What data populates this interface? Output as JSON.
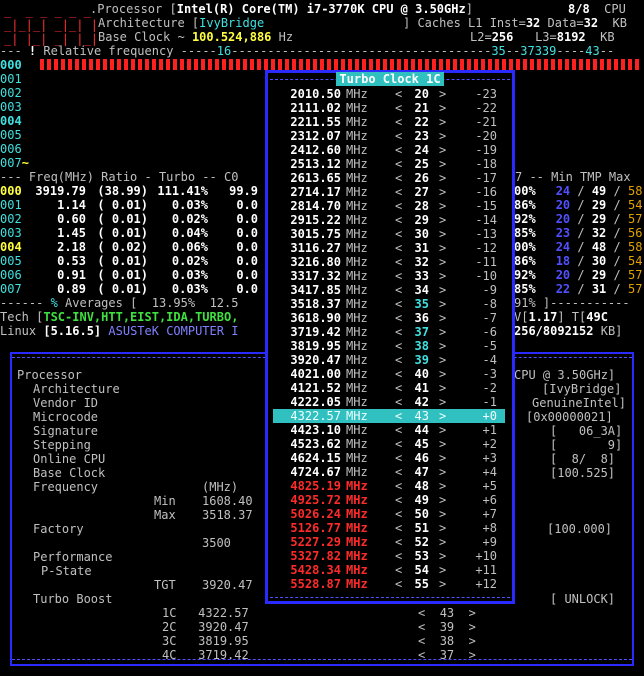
{
  "header": {
    "processor_label": "Processor [",
    "processor_name": "Intel(R) Core(TM) i7-3770K CPU @ 3.50GHz",
    "cpu_count": "8/8",
    "cpu_label": "CPU",
    "arch_label": "Architecture [",
    "arch_name": "IvyBridge",
    "caches_label": "] Caches L1 Inst=",
    "l1_inst": "32",
    "data_label": "Data=",
    "l1_data": "32",
    "kb": "KB",
    "base_clock_label": "Base Clock ~",
    "base_clock_value": "100.524,886",
    "hz": "Hz",
    "l2_label": "L2=",
    "l2": "256",
    "l3_label": "L3=",
    "l3": "8192"
  },
  "relfreq": {
    "label": "Relative frequency",
    "scale_a": "16",
    "scale_b": "35",
    "scale_c": "37",
    "scale_d": "339",
    "scale_e": "43"
  },
  "cores": [
    "000",
    "001",
    "002",
    "003",
    "004",
    "005",
    "006",
    "007"
  ],
  "freq_header": "--- Freq(MHz) Ratio - Turbo -- C0",
  "freq_header_right": "7 -- Min TMP Max",
  "freq_rows": [
    {
      "core": "000",
      "freq": "3919.79",
      "ratio": "(38.99)",
      "turbo": "111.41%",
      "c0": "99.9",
      "c7": "00%",
      "min": "24",
      "tmp": "49",
      "max": "58"
    },
    {
      "core": "001",
      "freq": "1.14",
      "ratio": "( 0.01)",
      "turbo": "0.03%",
      "c0": "0.0",
      "c7": "86%",
      "min": "20",
      "tmp": "29",
      "max": "54"
    },
    {
      "core": "002",
      "freq": "0.60",
      "ratio": "( 0.01)",
      "turbo": "0.02%",
      "c0": "0.0",
      "c7": "92%",
      "min": "20",
      "tmp": "29",
      "max": "57"
    },
    {
      "core": "003",
      "freq": "1.45",
      "ratio": "( 0.01)",
      "turbo": "0.04%",
      "c0": "0.0",
      "c7": "85%",
      "min": "23",
      "tmp": "32",
      "max": "56"
    },
    {
      "core": "004",
      "freq": "2.18",
      "ratio": "( 0.02)",
      "turbo": "0.06%",
      "c0": "0.0",
      "c7": "00%",
      "min": "24",
      "tmp": "48",
      "max": "58"
    },
    {
      "core": "005",
      "freq": "0.53",
      "ratio": "( 0.01)",
      "turbo": "0.02%",
      "c0": "0.0",
      "c7": "86%",
      "min": "18",
      "tmp": "30",
      "max": "54"
    },
    {
      "core": "006",
      "freq": "0.91",
      "ratio": "( 0.01)",
      "turbo": "0.03%",
      "c0": "0.0",
      "c7": "92%",
      "min": "20",
      "tmp": "29",
      "max": "57"
    },
    {
      "core": "007",
      "freq": "0.89",
      "ratio": "( 0.01)",
      "turbo": "0.03%",
      "c0": "0.0",
      "c7": "85%",
      "min": "22",
      "tmp": "31",
      "max": "57"
    }
  ],
  "averages": {
    "label": "Averages [",
    "turbo": "13.95%",
    "c0": "12.5",
    "c7": "91%"
  },
  "tech": {
    "label": "Tech [",
    "items": "TSC-INV,HTT,EIST,IDA,TURBO,",
    "vid_label": "V[",
    "vid": "1.17",
    "tdp_label": "] T[",
    "tdp": "49C"
  },
  "linux": {
    "label": "Linux",
    "version": "[5.16.5]",
    "board": "ASUSTeK COMPUTER I",
    "mem": "256/8092152",
    "kb": "KB]"
  },
  "turbo_popup": {
    "title": "Turbo Clock 1C",
    "mhz": "MHz",
    "rows": [
      {
        "f": "2010.50",
        "r": "20",
        "o": "-23",
        "red": false,
        "hl": false,
        "sel": false
      },
      {
        "f": "2111.02",
        "r": "21",
        "o": "-22",
        "red": false,
        "hl": false,
        "sel": false
      },
      {
        "f": "2211.55",
        "r": "22",
        "o": "-21",
        "red": false,
        "hl": false,
        "sel": false
      },
      {
        "f": "2312.07",
        "r": "23",
        "o": "-20",
        "red": false,
        "hl": false,
        "sel": false
      },
      {
        "f": "2412.60",
        "r": "24",
        "o": "-19",
        "red": false,
        "hl": false,
        "sel": false
      },
      {
        "f": "2513.12",
        "r": "25",
        "o": "-18",
        "red": false,
        "hl": false,
        "sel": false
      },
      {
        "f": "2613.65",
        "r": "26",
        "o": "-17",
        "red": false,
        "hl": false,
        "sel": false
      },
      {
        "f": "2714.17",
        "r": "27",
        "o": "-16",
        "red": false,
        "hl": false,
        "sel": false
      },
      {
        "f": "2814.70",
        "r": "28",
        "o": "-15",
        "red": false,
        "hl": false,
        "sel": false
      },
      {
        "f": "2915.22",
        "r": "29",
        "o": "-14",
        "red": false,
        "hl": false,
        "sel": false
      },
      {
        "f": "3015.75",
        "r": "30",
        "o": "-13",
        "red": false,
        "hl": false,
        "sel": false
      },
      {
        "f": "3116.27",
        "r": "31",
        "o": "-12",
        "red": false,
        "hl": false,
        "sel": false
      },
      {
        "f": "3216.80",
        "r": "32",
        "o": "-11",
        "red": false,
        "hl": false,
        "sel": false
      },
      {
        "f": "3317.32",
        "r": "33",
        "o": "-10",
        "red": false,
        "hl": false,
        "sel": false
      },
      {
        "f": "3417.85",
        "r": "34",
        "o": "-9",
        "red": false,
        "hl": false,
        "sel": false
      },
      {
        "f": "3518.37",
        "r": "35",
        "o": "-8",
        "red": false,
        "hl": true,
        "sel": false
      },
      {
        "f": "3618.90",
        "r": "36",
        "o": "-7",
        "red": false,
        "hl": false,
        "sel": false
      },
      {
        "f": "3719.42",
        "r": "37",
        "o": "-6",
        "red": false,
        "hl": true,
        "sel": false
      },
      {
        "f": "3819.95",
        "r": "38",
        "o": "-5",
        "red": false,
        "hl": true,
        "sel": false
      },
      {
        "f": "3920.47",
        "r": "39",
        "o": "-4",
        "red": false,
        "hl": true,
        "sel": false
      },
      {
        "f": "4021.00",
        "r": "40",
        "o": "-3",
        "red": false,
        "hl": false,
        "sel": false
      },
      {
        "f": "4121.52",
        "r": "41",
        "o": "-2",
        "red": false,
        "hl": false,
        "sel": false
      },
      {
        "f": "4222.05",
        "r": "42",
        "o": "-1",
        "red": false,
        "hl": false,
        "sel": false
      },
      {
        "f": "4322.57",
        "r": "43",
        "o": "+0",
        "red": false,
        "hl": false,
        "sel": true
      },
      {
        "f": "4423.10",
        "r": "44",
        "o": "+1",
        "red": false,
        "hl": false,
        "sel": false
      },
      {
        "f": "4523.62",
        "r": "45",
        "o": "+2",
        "red": false,
        "hl": false,
        "sel": false
      },
      {
        "f": "4624.15",
        "r": "46",
        "o": "+3",
        "red": false,
        "hl": false,
        "sel": false
      },
      {
        "f": "4724.67",
        "r": "47",
        "o": "+4",
        "red": false,
        "hl": false,
        "sel": false
      },
      {
        "f": "4825.19",
        "r": "48",
        "o": "+5",
        "red": true,
        "hl": false,
        "sel": false
      },
      {
        "f": "4925.72",
        "r": "49",
        "o": "+6",
        "red": true,
        "hl": false,
        "sel": false
      },
      {
        "f": "5026.24",
        "r": "50",
        "o": "+7",
        "red": true,
        "hl": false,
        "sel": false
      },
      {
        "f": "5126.77",
        "r": "51",
        "o": "+8",
        "red": true,
        "hl": false,
        "sel": false
      },
      {
        "f": "5227.29",
        "r": "52",
        "o": "+9",
        "red": true,
        "hl": false,
        "sel": false
      },
      {
        "f": "5327.82",
        "r": "53",
        "o": "+10",
        "red": true,
        "hl": false,
        "sel": false
      },
      {
        "f": "5428.34",
        "r": "54",
        "o": "+11",
        "red": true,
        "hl": false,
        "sel": false
      },
      {
        "f": "5528.87",
        "r": "55",
        "o": "+12",
        "red": true,
        "hl": false,
        "sel": false
      }
    ]
  },
  "proc_panel": {
    "processor": "Processor",
    "processor_right": "CPU @ 3.50GHz]",
    "architecture": "Architecture",
    "architecture_val": "[IvyBridge]",
    "vendor": "Vendor ID",
    "vendor_val": "GenuineIntel]",
    "microcode": "Microcode",
    "microcode_val": "[0x00000021]",
    "signature": "Signature",
    "signature_val": "[   06_3A]",
    "stepping": "Stepping",
    "stepping_val": "[       9]",
    "online": "Online CPU",
    "online_val": "[  8/  8]",
    "baseclock": "Base Clock",
    "baseclock_val": "[100.525]",
    "frequency": "Frequency",
    "mhz": "(MHz)",
    "min": "Min",
    "min_val": "1608.40",
    "max": "Max",
    "max_val": "3518.37",
    "factory": "Factory",
    "factory_val": "[100.000]",
    "factory_freq": "3500",
    "performance": "Performance",
    "pstate": "P-State",
    "tgt": "TGT",
    "tgt_val": "3920.47",
    "turbo_boost": "Turbo Boost",
    "turbo_boost_val": "[ UNLOCK]",
    "turbo": [
      {
        "label": "1C",
        "val": "4322.57",
        "ratio": "43"
      },
      {
        "label": "2C",
        "val": "3920.47",
        "ratio": "39"
      },
      {
        "label": "3C",
        "val": "3819.95",
        "ratio": "38"
      },
      {
        "label": "4C",
        "val": "3719.42",
        "ratio": "37"
      }
    ]
  },
  "colors": {
    "accent_blue": "#2a2aff",
    "cyan": "#30c0c0",
    "red": "#ff2a2a",
    "yellow": "#ffff40"
  }
}
